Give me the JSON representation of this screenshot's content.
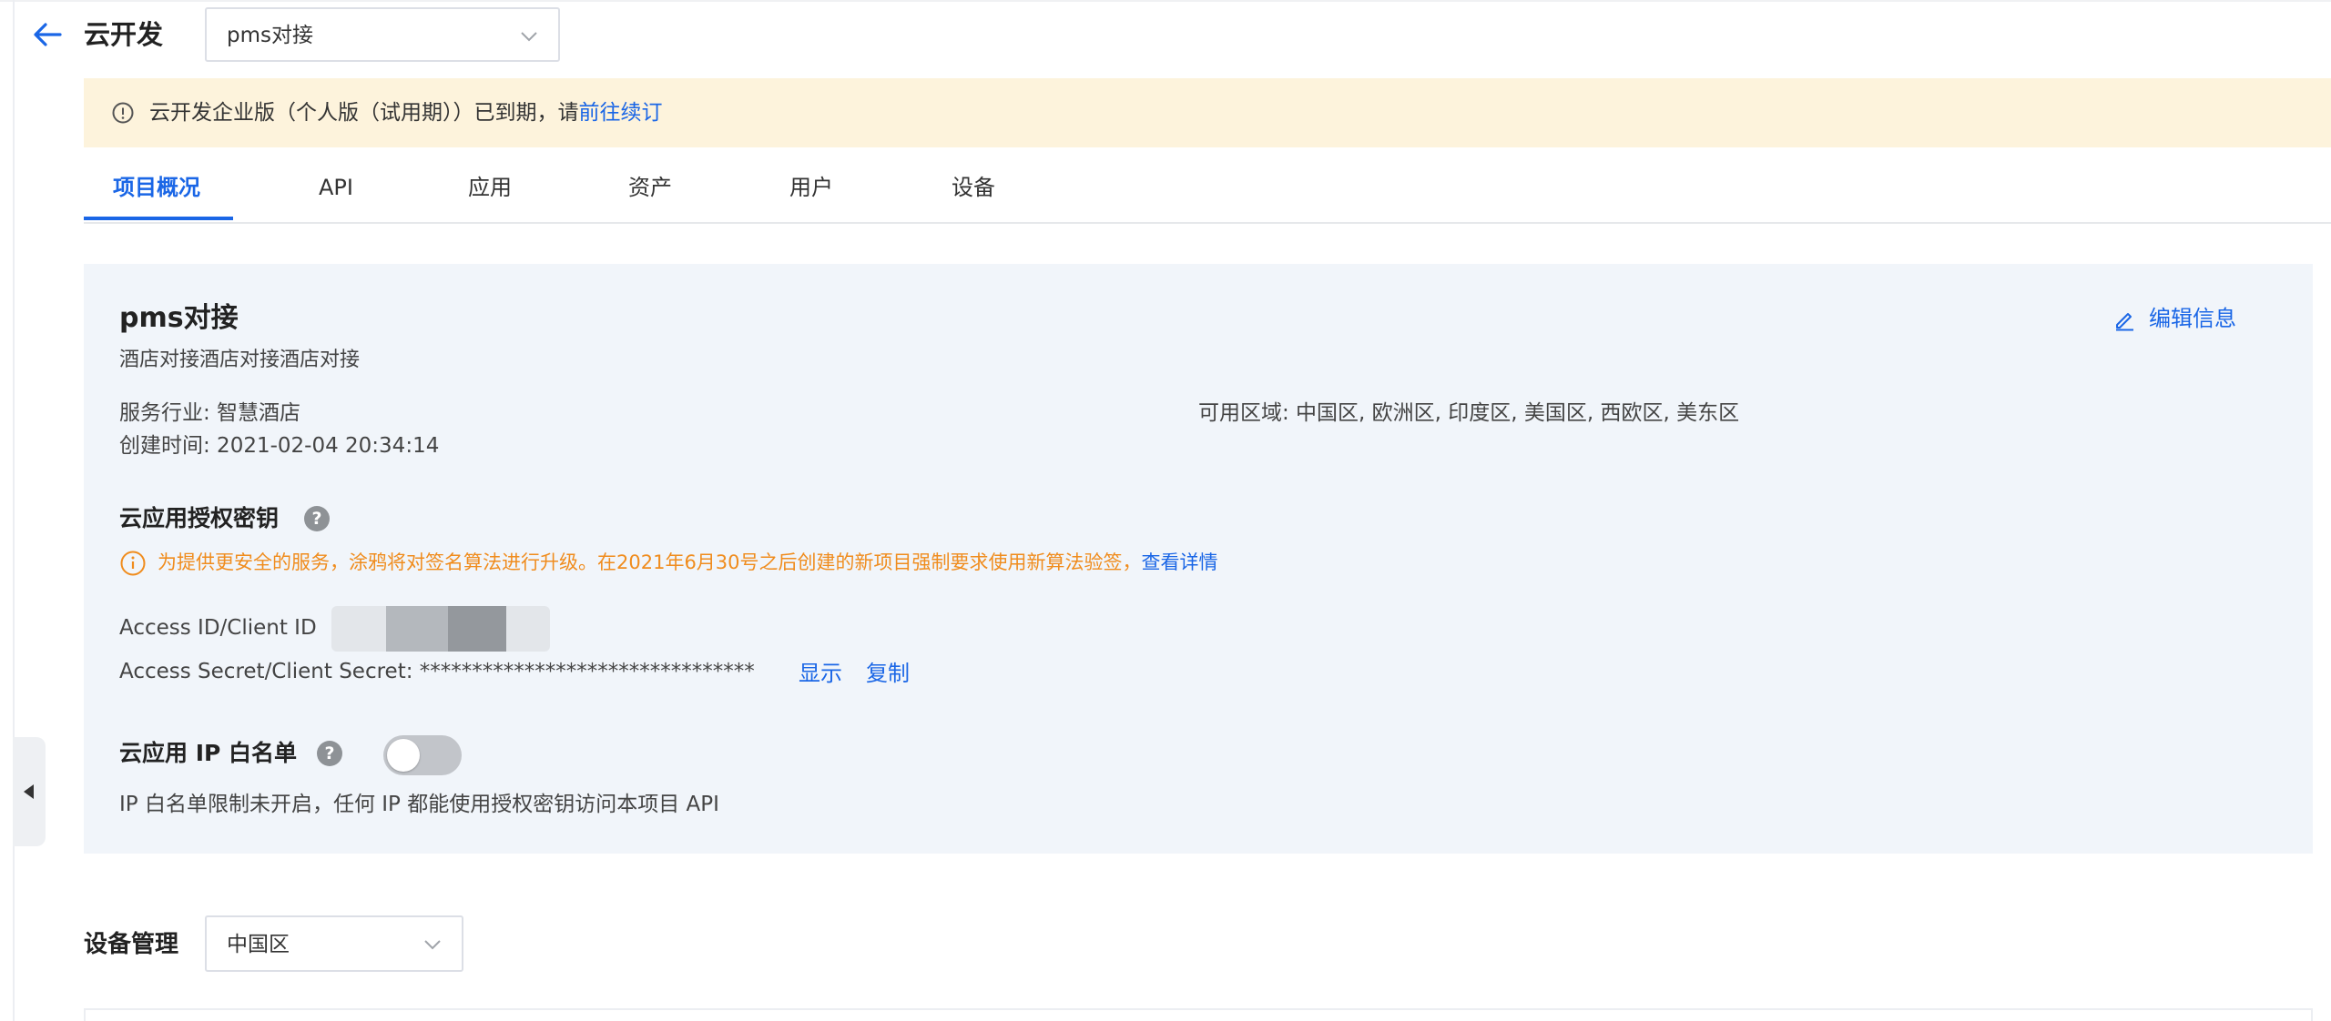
{
  "header": {
    "title": "云开发",
    "project_select_value": "pms对接"
  },
  "banner": {
    "text": "云开发企业版（个人版（试用期））已到期，请",
    "link": "前往续订"
  },
  "tabs": [
    {
      "label": "项目概况",
      "active": true
    },
    {
      "label": "API"
    },
    {
      "label": "应用"
    },
    {
      "label": "资产"
    },
    {
      "label": "用户"
    },
    {
      "label": "设备"
    }
  ],
  "project": {
    "name": "pms对接",
    "description": "酒店对接酒店对接酒店对接",
    "edit_label": "编辑信息",
    "industry": "服务行业: 智慧酒店",
    "created": "创建时间: 2021-02-04 20:34:14",
    "regions": "可用区域: 中国区, 欧洲区, 印度区, 美国区, 西欧区, 美东区"
  },
  "auth_key": {
    "title": "云应用授权密钥",
    "help": "?",
    "notice": "为提供更安全的服务，涂鸦将对签名算法进行升级。在2021年6月30号之后创建的新项目强制要求使用新算法验签，",
    "notice_link": "查看详情",
    "access_id_label": "Access ID/Client ID",
    "access_secret": "Access Secret/Client Secret: ********************************",
    "show_label": "显示",
    "copy_label": "复制"
  },
  "ip_whitelist": {
    "title": "云应用 IP 白名单",
    "help": "?",
    "enabled": false,
    "description": "IP 白名单限制未开启，任何 IP 都能使用授权密钥访问本项目 API"
  },
  "device_management": {
    "label": "设备管理",
    "region_value": "中国区"
  },
  "colors": {
    "accent": "#1a66e6",
    "banner_bg": "#fdf3dc",
    "card_bg": "#f1f5fa",
    "warning": "#f08c1d"
  }
}
